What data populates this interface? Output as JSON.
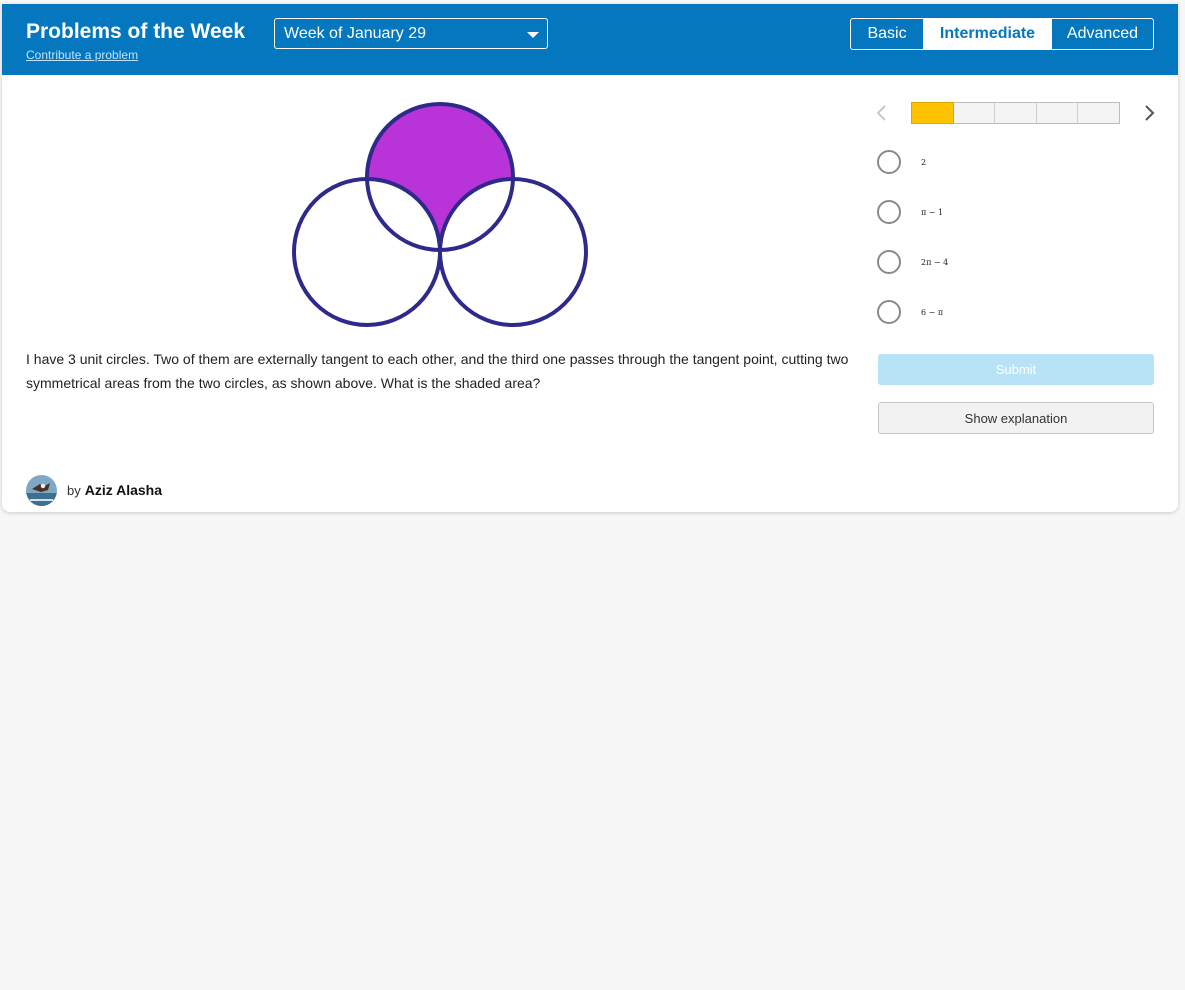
{
  "header": {
    "title": "Problems of the Week",
    "contribute_link": "Contribute a problem",
    "week_select": {
      "value": "Week of January 29"
    },
    "levels": [
      {
        "label": "Basic",
        "selected": false
      },
      {
        "label": "Intermediate",
        "selected": true
      },
      {
        "label": "Advanced",
        "selected": false
      }
    ]
  },
  "problem": {
    "text": "I have 3 unit circles. Two of them are externally tangent to each other, and the third one passes through the tangent point, cutting two symmetrical areas from the two circles, as shown above. What is the shaded area?",
    "figure": {
      "description_icon": "three-circles-diagram",
      "shade_color": "#b834d9",
      "stroke_color": "#2e2a8c"
    },
    "author": {
      "by": "by",
      "name": "Aziz Alasha"
    }
  },
  "quiz": {
    "progress": {
      "total": 5,
      "current": 1
    },
    "choices": [
      {
        "label": "2"
      },
      {
        "label": "π − 1"
      },
      {
        "label": "2π − 4"
      },
      {
        "label": "6 − π"
      }
    ],
    "submit_label": "Submit",
    "explanation_label": "Show explanation"
  },
  "colors": {
    "header_bg": "#0477bf",
    "progress_active": "#fdc300",
    "submit_disabled": "#b8e2f6"
  }
}
